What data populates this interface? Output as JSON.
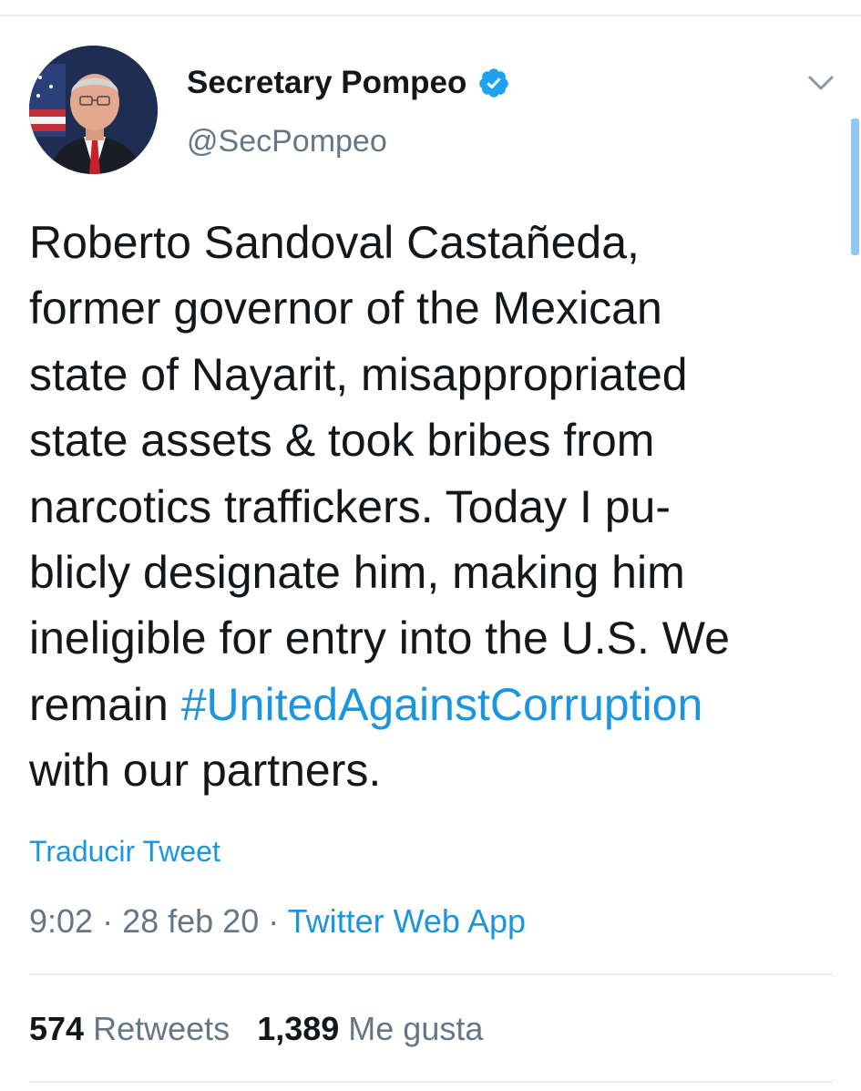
{
  "author": {
    "display_name": "Secretary Pompeo",
    "handle": "@SecPompeo",
    "verified_icon": "verified-badge-icon",
    "avatar": "profile-photo"
  },
  "tweet": {
    "lines": [
      "Roberto Sandoval Castañeda,",
      "former governor of the Mexican",
      "state of Nayarit, misappropriated",
      "state assets & took bribes from",
      "narcotics traffickers. Today I pu-",
      "blicly designate him, making him",
      "ineligible for entry into the U.S. We"
    ],
    "line8_prefix": "remain ",
    "hashtag": "#UnitedAgainstCorruption",
    "last_line": "with our partners."
  },
  "translate_label": "Traducir Tweet",
  "meta": {
    "time": "9:02",
    "sep1": " · ",
    "date": "28 feb 20",
    "sep2": " · ",
    "source": "Twitter Web App"
  },
  "stats": {
    "retweets_count": "574",
    "retweets_label": "Retweets",
    "likes_count": "1,389",
    "likes_label": "Me gusta"
  },
  "colors": {
    "link": "#1b95e0",
    "secondary_text": "#657786",
    "primary_text": "#14171a",
    "divider": "#e6ecf0"
  }
}
